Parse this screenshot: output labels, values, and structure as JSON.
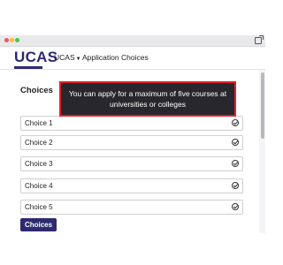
{
  "brand": {
    "logo_text": "UCAS"
  },
  "nav": {
    "items": [
      {
        "label": "UCAS",
        "has_dropdown": true
      },
      {
        "label": "Application"
      },
      {
        "label": "Choices"
      }
    ]
  },
  "main": {
    "section_title": "Choices",
    "tooltip_text": "You can apply for a maximum of five courses at universities or colleges",
    "choices": [
      {
        "label": "Choice 1"
      },
      {
        "label": "Choice 2"
      },
      {
        "label": "Choice 3"
      },
      {
        "label": "Choice 4"
      },
      {
        "label": "Choice 5"
      }
    ],
    "button_label": "Choices"
  },
  "colors": {
    "brand": "#2d2a6e",
    "tooltip_bg": "#27272d",
    "highlight_border": "#e0212c"
  }
}
